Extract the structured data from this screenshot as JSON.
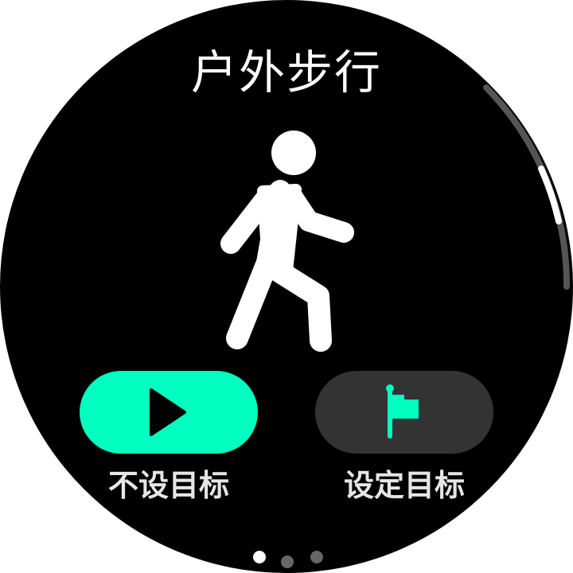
{
  "workout": {
    "title": "户外步行",
    "icon": "walking-person-icon"
  },
  "actions": {
    "start": {
      "label": "不设目标",
      "icon": "play-icon",
      "color": "#00ffc0"
    },
    "goal": {
      "label": "设定目标",
      "icon": "flag-icon",
      "color": "#333333",
      "icon_color": "#00ffc0"
    }
  },
  "pager": {
    "pages": 3,
    "current": 1
  },
  "colors": {
    "background": "#000000",
    "text": "#ffffff",
    "label": "#e6e6e6",
    "dot_active": "#ffffff",
    "dot_inactive": "#666666",
    "scroll_track": "#555555",
    "scroll_thumb": "#ffffff"
  }
}
